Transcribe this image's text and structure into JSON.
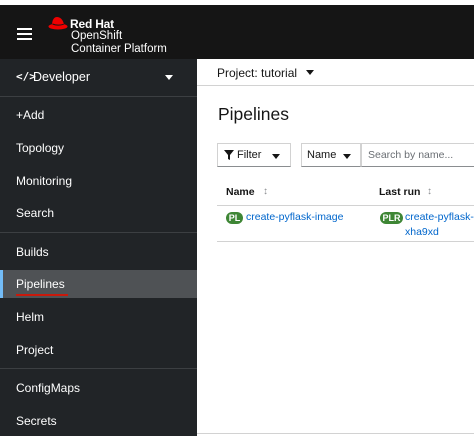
{
  "masthead": {
    "brand_line1": "Red Hat",
    "brand_line2": "OpenShift",
    "brand_line3": "Container Platform"
  },
  "sidebar": {
    "perspective_label": "Developer",
    "items": [
      {
        "label": "+Add"
      },
      {
        "label": "Topology"
      },
      {
        "label": "Monitoring"
      },
      {
        "label": "Search"
      },
      {
        "label": "Builds"
      },
      {
        "label": "Pipelines",
        "active": true
      },
      {
        "label": "Helm"
      },
      {
        "label": "Project"
      },
      {
        "label": "ConfigMaps"
      },
      {
        "label": "Secrets"
      }
    ]
  },
  "project_bar": {
    "label": "Project: tutorial"
  },
  "page": {
    "title": "Pipelines"
  },
  "toolbar": {
    "filter_label": "Filter",
    "name_select_value": "Name",
    "search_placeholder": "Search by name..."
  },
  "table": {
    "columns": [
      "Name",
      "Last run"
    ],
    "rows": [
      {
        "name_badge": "PL",
        "name": "create-pyflask-image",
        "last_run_badge": "PLR",
        "last_run_line1": "create-pyflask-i",
        "last_run_line2": "xha9xd"
      }
    ]
  },
  "colors": {
    "masthead_bg": "#151515",
    "sidebar_bg": "#212427",
    "active_item_bg": "#4f5255",
    "brand_red": "#ee0000",
    "link_blue": "#0066cc",
    "badge_green": "#3e8635"
  }
}
